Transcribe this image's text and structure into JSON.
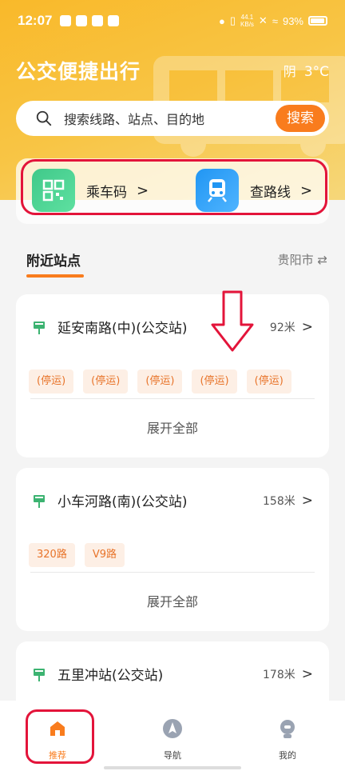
{
  "status_bar": {
    "time": "12:07",
    "network_speed": "44.1",
    "network_unit": "KB/s",
    "battery": "93%"
  },
  "header": {
    "title": "公交便捷出行",
    "weather": "阴",
    "temperature": "3°C"
  },
  "search": {
    "placeholder": "搜索线路、站点、目的地",
    "button": "搜索"
  },
  "quick_actions": [
    {
      "label": "乘车码",
      "icon": "qr-code-icon",
      "chevron": ">"
    },
    {
      "label": "查路线",
      "icon": "train-icon",
      "chevron": ">"
    }
  ],
  "nearby": {
    "title": "附近站点",
    "city": "贵阳市 ⇄"
  },
  "stations": [
    {
      "name": "延安南路(中)(公交站)",
      "distance": "92米",
      "chevron": ">",
      "tags": [
        "(停运)",
        "(停运)",
        "(停运)",
        "(停运)",
        "(停运)"
      ],
      "expand": "展开全部"
    },
    {
      "name": "小车河路(南)(公交站)",
      "distance": "158米",
      "chevron": ">",
      "tags": [
        "320路",
        "V9路"
      ],
      "expand": "展开全部"
    },
    {
      "name": "五里冲站(公交站)",
      "distance": "178米",
      "chevron": ">"
    }
  ],
  "tabs": [
    {
      "label": "推荐",
      "icon": "home-icon",
      "active": true
    },
    {
      "label": "导航",
      "icon": "compass-icon",
      "active": false
    },
    {
      "label": "我的",
      "icon": "profile-icon",
      "active": false
    }
  ],
  "colors": {
    "accent": "#f97c1d",
    "hero": "#f9b92a",
    "annotation": "#e3143a"
  }
}
